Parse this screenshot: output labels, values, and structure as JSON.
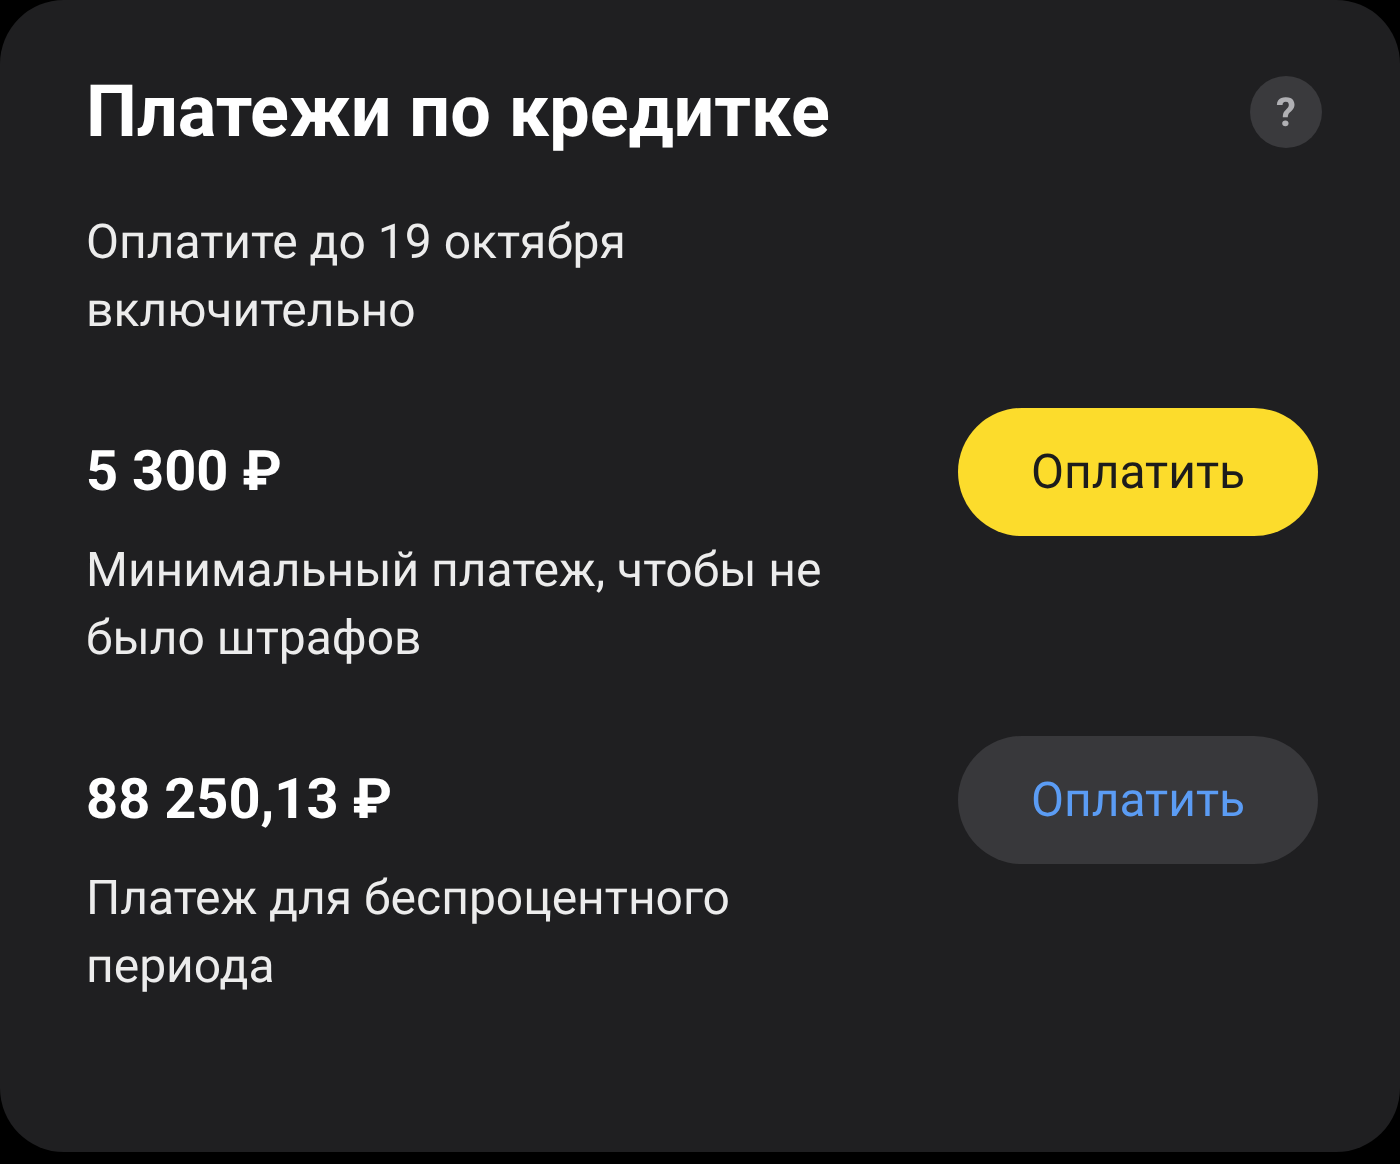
{
  "title": "Платежи по кредитке",
  "help": {
    "label": "?"
  },
  "subtitle": "Оплатите до 19 октября включительно",
  "payments": [
    {
      "amount": "5 300 ₽",
      "description": "Минимальный платеж, чтобы не было штрафов",
      "button": {
        "label": "Оплатить",
        "kind": "primary"
      }
    },
    {
      "amount": "88 250,13 ₽",
      "description": "Платеж для беспроцентного периода",
      "button": {
        "label": "Оплатить",
        "kind": "secondary"
      }
    }
  ]
}
